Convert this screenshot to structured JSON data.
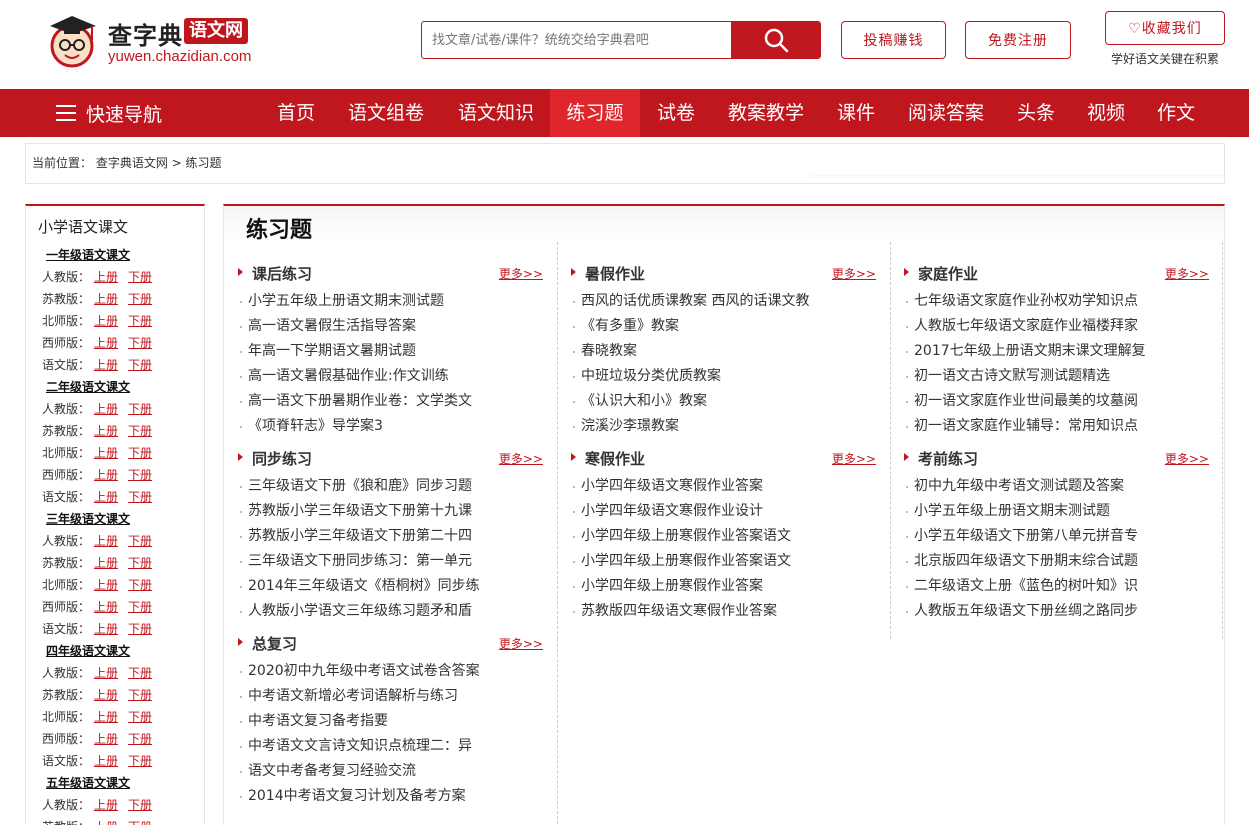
{
  "brand": {
    "name": "查字典",
    "badge": "语文网",
    "url": "yuwen.chazidian.com"
  },
  "search": {
    "placeholder": "找文章/试卷/课件？统统交给字典君吧"
  },
  "header_buttons": {
    "submit": "投稿赚钱",
    "register": "免费注册",
    "favorite": "♡收藏我们",
    "slogan": "学好语文关键在积累"
  },
  "nav": {
    "quick": "快速导航",
    "items": [
      "首页",
      "语文组卷",
      "语文知识",
      "练习题",
      "试卷",
      "教案教学",
      "课件",
      "阅读答案",
      "头条",
      "视频",
      "作文"
    ],
    "active_index": 3
  },
  "breadcrumb": {
    "label": "当前位置：",
    "path": "查字典语文网 > 练习题"
  },
  "sidebar": {
    "title": "小学语文课文",
    "grades": [
      {
        "name": "一年级语文课文",
        "editions": [
          "人教版：",
          "苏教版：",
          "北师版：",
          "西师版：",
          "语文版："
        ]
      },
      {
        "name": "二年级语文课文",
        "editions": [
          "人教版：",
          "苏教版：",
          "北师版：",
          "西师版：",
          "语文版："
        ]
      },
      {
        "name": "三年级语文课文",
        "editions": [
          "人教版：",
          "苏教版：",
          "北师版：",
          "西师版：",
          "语文版："
        ]
      },
      {
        "name": "四年级语文课文",
        "editions": [
          "人教版：",
          "苏教版：",
          "北师版：",
          "西师版：",
          "语文版："
        ]
      },
      {
        "name": "五年级语文课文",
        "editions": [
          "人教版：",
          "苏教版："
        ]
      }
    ],
    "up": "上册",
    "down": "下册"
  },
  "main": {
    "title": "练习题",
    "more": "更多>>",
    "blocks": [
      {
        "title": "课后练习",
        "items": [
          "小学五年级上册语文期末测试题",
          "高一语文暑假生活指导答案",
          "年高一下学期语文暑期试题",
          "高一语文暑假基础作业:作文训练",
          "高一语文下册暑期作业卷：文学类文",
          "《项脊轩志》导学案3"
        ]
      },
      {
        "title": "暑假作业",
        "items": [
          "西风的话优质课教案 西风的话课文教",
          "《有多重》教案",
          "春晓教案",
          "中班垃圾分类优质教案",
          "《认识大和小》教案",
          "浣溪沙李璟教案"
        ]
      },
      {
        "title": "家庭作业",
        "items": [
          "七年级语文家庭作业孙权劝学知识点",
          "人教版七年级语文家庭作业福楼拜家",
          "2017七年级上册语文期末课文理解复",
          "初一语文古诗文默写测试题精选",
          "初一语文家庭作业世间最美的坟墓阅",
          "初一语文家庭作业辅导：常用知识点"
        ]
      },
      {
        "title": "同步练习",
        "items": [
          "三年级语文下册《狼和鹿》同步习题",
          "苏教版小学三年级语文下册第十九课",
          "苏教版小学三年级语文下册第二十四",
          "三年级语文下册同步练习：第一单元",
          "2014年三年级语文《梧桐树》同步练",
          "人教版小学语文三年级练习题矛和盾"
        ]
      },
      {
        "title": "寒假作业",
        "items": [
          "小学四年级语文寒假作业答案",
          "小学四年级语文寒假作业设计",
          "小学四年级上册寒假作业答案语文",
          "小学四年级上册寒假作业答案语文",
          "小学四年级上册寒假作业答案",
          "苏教版四年级语文寒假作业答案"
        ]
      },
      {
        "title": "考前练习",
        "items": [
          "初中九年级中考语文测试题及答案",
          "小学五年级上册语文期末测试题",
          "小学五年级语文下册第八单元拼音专",
          "北京版四年级语文下册期末综合试题",
          "二年级语文上册《蓝色的树叶知》识",
          "人教版五年级语文下册丝绸之路同步"
        ]
      },
      {
        "title": "总复习",
        "items": [
          "2020初中九年级中考语文试卷含答案",
          "中考语文新增必考词语解析与练习",
          "中考语文复习备考指要",
          "中考语文文言诗文知识点梳理二：异",
          "语文中考备考复习经验交流",
          "2014中考语文复习计划及备考方案"
        ]
      }
    ]
  },
  "colors": {
    "brand_red": "#c0171f",
    "nav_active": "#e0262d"
  }
}
